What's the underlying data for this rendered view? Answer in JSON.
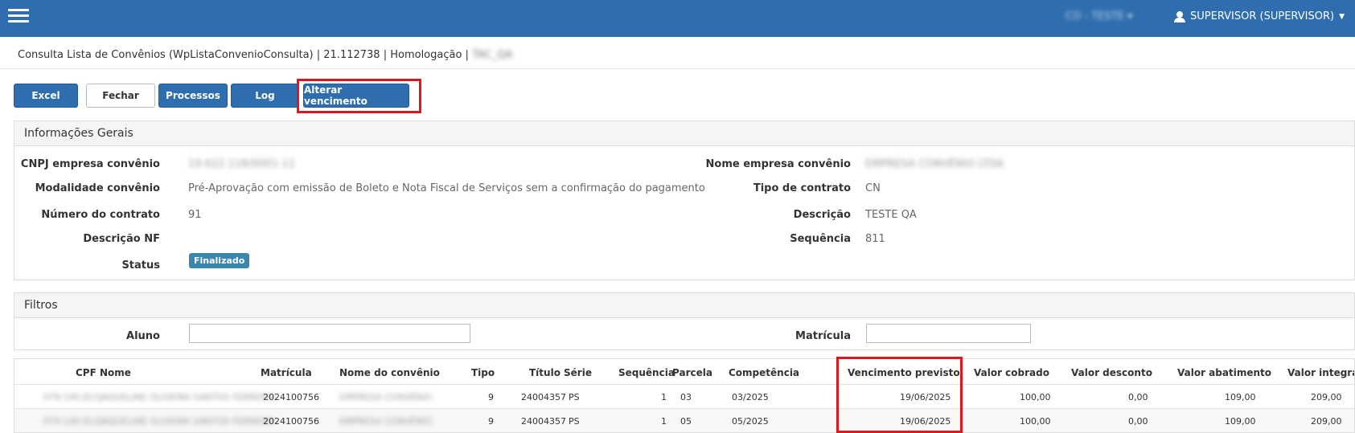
{
  "topbar": {
    "environment": "CO - TESTE",
    "user": "SUPERVISOR (SUPERVISOR)",
    "accent_color": "#2f6eae"
  },
  "breadcrumb": {
    "text": "Consulta Lista de Convênios (WpListaConvenioConsulta) | 21.112738 | Homologação |",
    "db": "TAC_QA"
  },
  "toolbar": {
    "excel": "Excel",
    "fechar": "Fechar",
    "processos": "Processos",
    "log": "Log",
    "alterar": "Alterar vencimento"
  },
  "info": {
    "heading": "Informações Gerais",
    "cnpj_label": "CNPJ empresa convênio",
    "cnpj_value": "19.622.118/0001-11",
    "nome_label": "Nome empresa convênio",
    "nome_value": "EMPRESA CONVÊNIO LTDA",
    "modalidade_label": "Modalidade convênio",
    "modalidade_value": "Pré-Aprovação com emissão de Boleto e Nota Fiscal de Serviços sem a confirmação do pagamento",
    "tipo_label": "Tipo de contrato",
    "tipo_value": "CN",
    "numero_label": "Número do contrato",
    "numero_value": "91",
    "descricao_label": "Descrição",
    "descricao_value": "TESTE QA",
    "descnf_label": "Descrição NF",
    "sequencia_label": "Sequência",
    "sequencia_value": "811",
    "status_label": "Status",
    "status_value": "Finalizado"
  },
  "filtros": {
    "heading": "Filtros",
    "aluno_label": "Aluno",
    "matricula_label": "Matrícula"
  },
  "table": {
    "headers": [
      "CPF",
      "Nome",
      "Matrícula",
      "Nome do convênio",
      "Tipo",
      "Título",
      "Série",
      "Sequência",
      "Parcela",
      "Competência",
      "Vencimento previsto",
      "Valor cobrado",
      "Valor desconto",
      "Valor abatimento",
      "Valor integral"
    ],
    "rows": [
      {
        "cpf": "079.140.813",
        "nome": "JAQUELINE OLIVEIRA SANTOS FERREIRA",
        "matricula": "2024100756",
        "convenio": "EMPRESA CONVÊNIO",
        "tipo": "9",
        "titulo": "24004357",
        "serie": "PS",
        "sequencia": "1",
        "parcela": "03",
        "competencia": "03/2025",
        "vencimento": "19/06/2025",
        "cobrado": "100,00",
        "desconto": "0,00",
        "abatimento": "109,00",
        "integral": "209,00"
      },
      {
        "cpf": "079.140.813",
        "nome": "JAQUELINE OLIVEIRA SANTOS FERREIRA",
        "matricula": "2024100756",
        "convenio": "EMPRESA CONVÊNIO",
        "tipo": "9",
        "titulo": "24004357",
        "serie": "PS",
        "sequencia": "1",
        "parcela": "05",
        "competencia": "05/2025",
        "vencimento": "19/06/2025",
        "cobrado": "100,00",
        "desconto": "0,00",
        "abatimento": "109,00",
        "integral": "209,00"
      }
    ]
  }
}
